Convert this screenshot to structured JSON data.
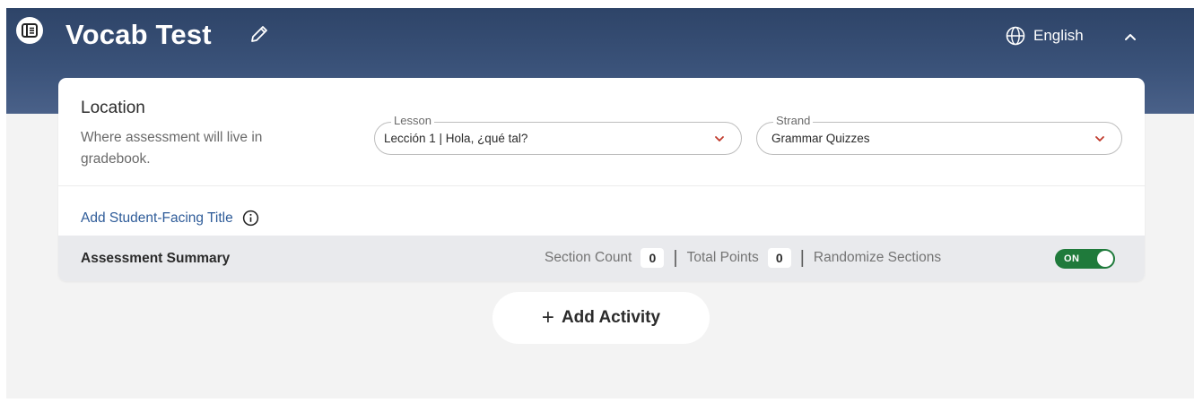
{
  "header": {
    "title": "Vocab Test",
    "language": "English",
    "icons": {
      "sidebar_toggle": "sidebar-panel-icon",
      "edit": "pencil-icon",
      "globe": "globe-icon",
      "collapse": "chevron-up-icon"
    }
  },
  "location": {
    "title": "Location",
    "description": "Where assessment will live in gradebook.",
    "lesson": {
      "label": "Lesson",
      "value": "Lección 1 | Hola, ¿qué tal?"
    },
    "strand": {
      "label": "Strand",
      "value": "Grammar Quizzes"
    }
  },
  "student_title": {
    "link": "Add Student-Facing Title"
  },
  "summary": {
    "title": "Assessment Summary",
    "section_count_label": "Section Count",
    "section_count": "0",
    "total_points_label": "Total Points",
    "total_points": "0",
    "randomize_label": "Randomize Sections",
    "toggle_state": "ON"
  },
  "add_activity": {
    "label": "Add Activity"
  },
  "colors": {
    "header": "#3a5279",
    "accent_link": "#2f5c99",
    "toggle_on": "#1f7a3b",
    "chevron": "#c0392b"
  }
}
